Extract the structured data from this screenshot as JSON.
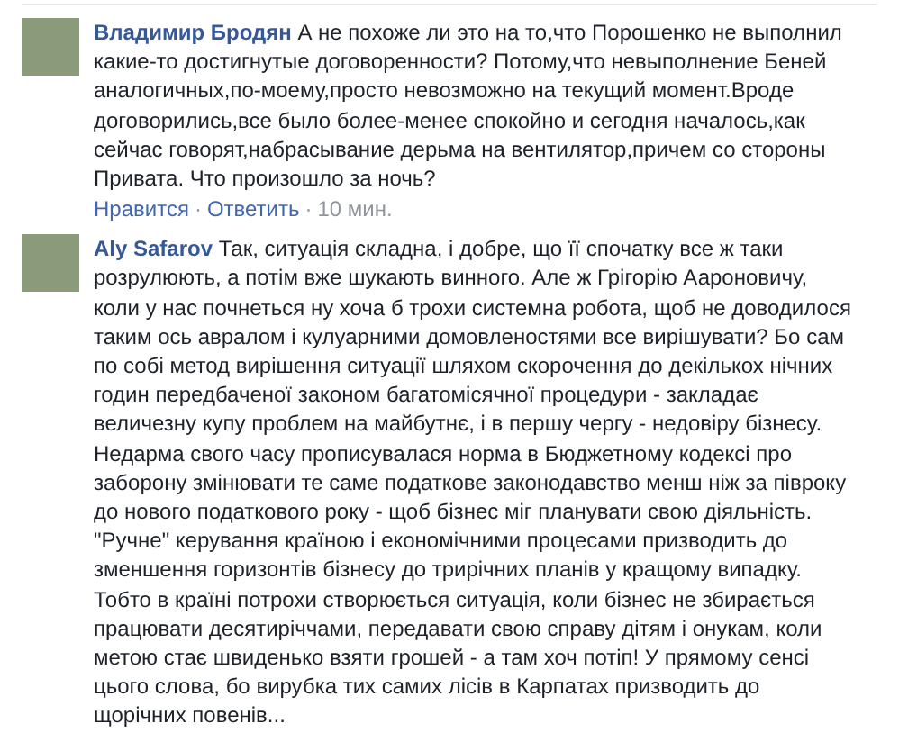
{
  "comments": [
    {
      "author": "Владимир Бродян",
      "text": "А не похоже ли это на то,что Порошенко не выполнил какие-то достигнутые договоренности? Потому,что невыполнение Беней аналогичных,по-моему,просто невозможно на текущий момент.Вроде договорились,все было более-менее спокойно и сегодня началось,как сейчас говорят,набрасывание дерьма на вентилятор,причем со стороны Привата. Что произошло за ночь?",
      "footer": [
        {
          "kind": "link",
          "text": "Нравится"
        },
        {
          "kind": "dot",
          "text": "·"
        },
        {
          "kind": "link",
          "text": "Ответить"
        },
        {
          "kind": "dot",
          "text": "·"
        },
        {
          "kind": "time",
          "text": "10 мин."
        }
      ]
    },
    {
      "author": "Aly Safarov",
      "text": "Так, ситуація складна, і добре, що її спочатку все ж таки розрулюють, а потім вже шукають винного. Але ж Грігорію Аароновичу, коли у нас почнеться ну хоча б трохи системна робота, щоб не доводилося таким ось авралом і кулуарними домовленостями все вирішувати? Бо сам по собі метод вирішення ситуації шляхом скорочення до декількох нічних годин передбаченої законом багатомісячної процедури - закладає величезну купу проблем на майбутнє, і в першу чергу - недовіру бізнесу. Недарма свого часу прописувалася норма в Бюджетному кодексі про заборону змінювати те саме податкове законодавство менш ніж за півроку до нового податкового року - щоб бізнес міг планувати свою діяльність. \"Ручне\" керування країною і економічними процесами призводить до зменшення горизонтів бізнесу до трирічних планів у кращому випадку. Тобто в країні потрохи створюється ситуація, коли бізнес не збирається працювати десятиріччами, передавати свою справу дітям і онукам, коли метою стає швиденько взяти грошей - а там хоч потіп! У прямому сенсі цього слова, бо вирубка тих самих лісів в Карпатах призводить до щорічних повенів..."
    }
  ]
}
